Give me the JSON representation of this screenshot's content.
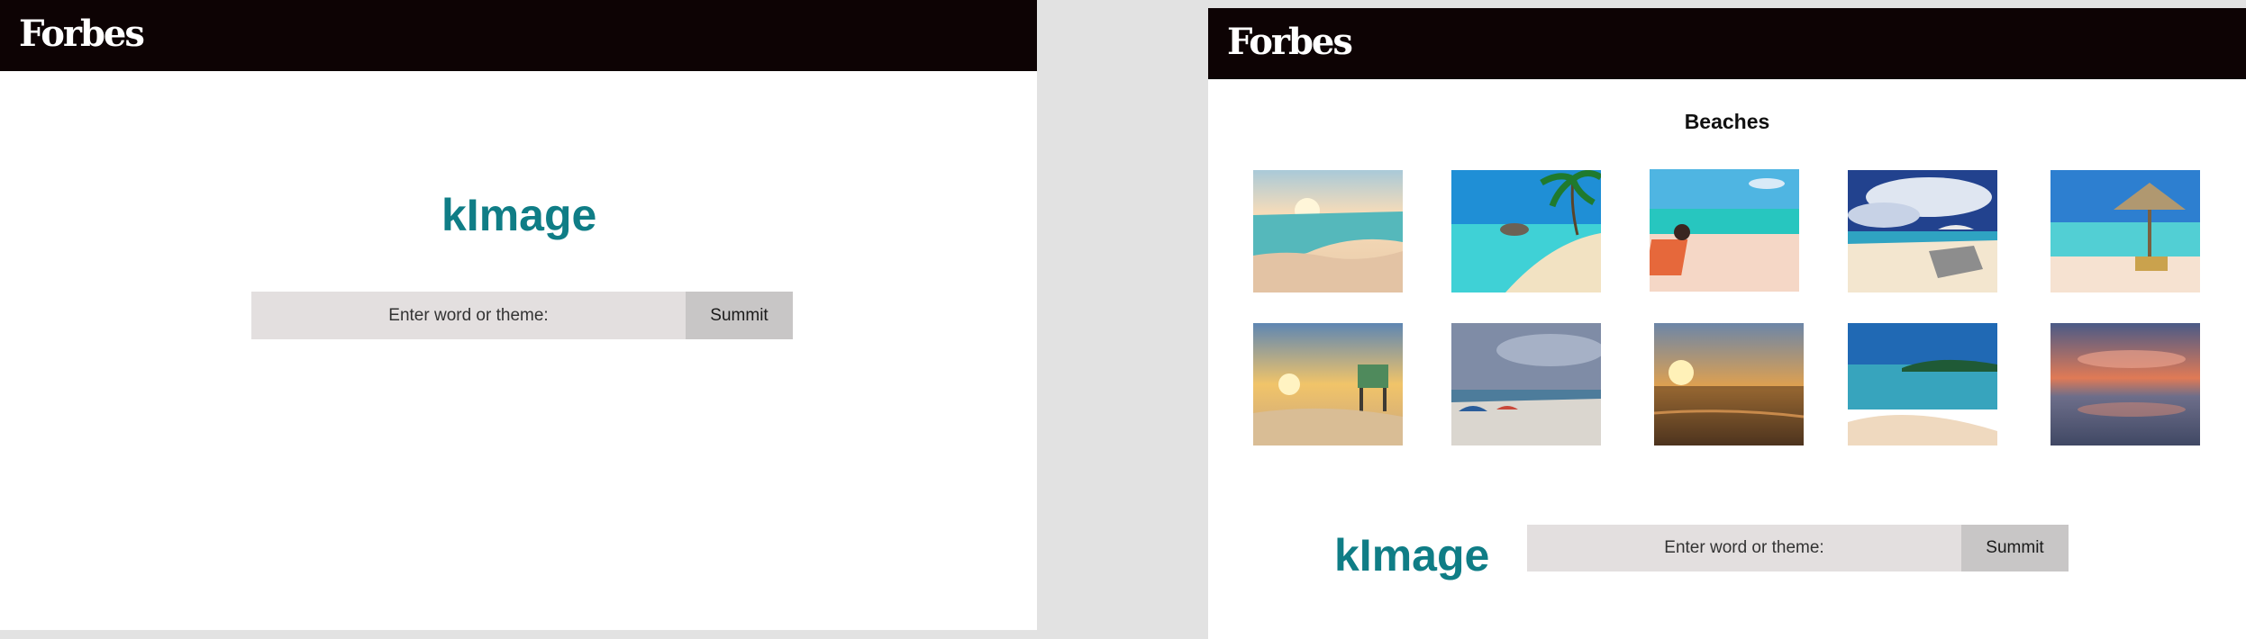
{
  "left_screen": {
    "logo": "Forbes",
    "brand": "kImage",
    "search": {
      "placeholder": "Enter word or theme:",
      "submit_label": "Summit"
    }
  },
  "right_screen": {
    "logo": "Forbes",
    "gallery": {
      "title": "Beaches",
      "images": [
        {
          "name": "beach-sunrise-waves-photo"
        },
        {
          "name": "tropical-beach-palms-photo"
        },
        {
          "name": "woman-in-beach-chair-photo"
        },
        {
          "name": "beach-loungers-clouds-photo"
        },
        {
          "name": "thatched-umbrella-beach-photo"
        },
        {
          "name": "lifeguard-tower-sunset-photo"
        },
        {
          "name": "crowded-beach-umbrellas-photo"
        },
        {
          "name": "ocean-sunset-photo"
        },
        {
          "name": "palm-island-shore-photo"
        },
        {
          "name": "reflective-sunset-beach-photo"
        }
      ]
    },
    "brand": "kImage",
    "search": {
      "placeholder": "Enter word or theme:",
      "submit_label": "Summit"
    }
  }
}
